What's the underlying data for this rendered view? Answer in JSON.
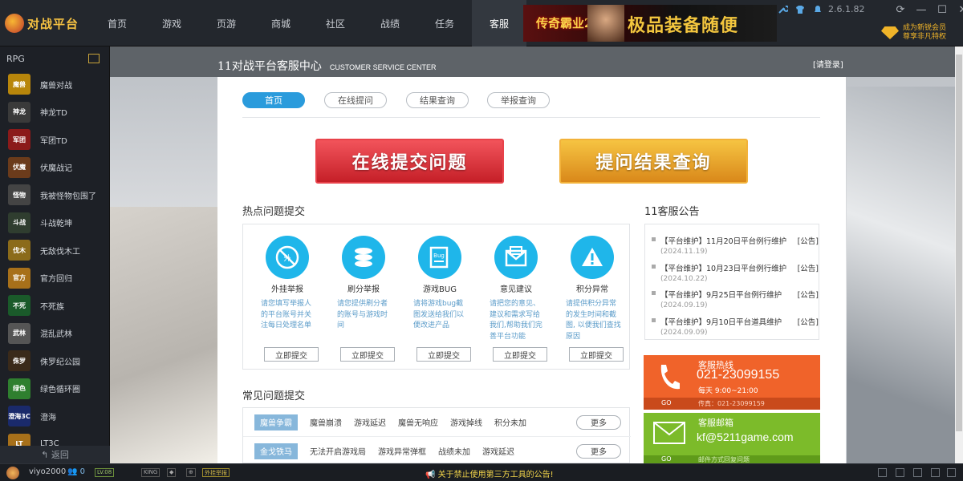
{
  "app": {
    "logo_text": "对战平台",
    "version": "2.6.1.82",
    "vip_line1": "成为新锐会员",
    "vip_line2": "尊享非凡特权"
  },
  "nav": [
    {
      "label": "首页",
      "active": false
    },
    {
      "label": "游戏",
      "active": false
    },
    {
      "label": "页游",
      "active": false
    },
    {
      "label": "商城",
      "active": false
    },
    {
      "label": "社区",
      "active": false
    },
    {
      "label": "战绩",
      "active": false
    },
    {
      "label": "任务",
      "active": false
    },
    {
      "label": "客服",
      "active": true
    }
  ],
  "banner": {
    "game_title": "传奇霸业2",
    "slogan": "极品装备随便"
  },
  "sidebar": {
    "category": "RPG",
    "back_label": "返回",
    "games": [
      {
        "name": "魔兽对战",
        "icon_text": "魔兽",
        "color": "#b8860b"
      },
      {
        "name": "神龙TD",
        "icon_text": "神龙",
        "color": "#3a3a3a"
      },
      {
        "name": "军团TD",
        "icon_text": "军团",
        "color": "#8b1a1a"
      },
      {
        "name": "伏魔战记",
        "icon_text": "伏魔",
        "color": "#6b3b1b"
      },
      {
        "name": "我被怪物包围了",
        "icon_text": "怪物",
        "color": "#444"
      },
      {
        "name": "斗战乾坤",
        "icon_text": "斗战",
        "color": "#2f3d2f"
      },
      {
        "name": "无敌伐木工",
        "icon_text": "伐木",
        "color": "#8b6b1a"
      },
      {
        "name": "官方回归",
        "icon_text": "官方",
        "color": "#a7701a"
      },
      {
        "name": "不死族",
        "icon_text": "不死",
        "color": "#1a5a2a"
      },
      {
        "name": "混乱武林",
        "icon_text": "武林",
        "color": "#555"
      },
      {
        "name": "侏罗纪公园",
        "icon_text": "侏罗",
        "color": "#3a2a1a"
      },
      {
        "name": "绿色循环圈",
        "icon_text": "绿色",
        "color": "#2f7f2f"
      },
      {
        "name": "澄海",
        "icon_text": "澄海3C",
        "color": "#1a2a6b"
      },
      {
        "name": "LT3C",
        "icon_text": "LT",
        "color": "#a7701a"
      }
    ]
  },
  "service": {
    "title": "11对战平台客服中心",
    "title_en": "CUSTOMER SERVICE CENTER",
    "login": "[请登录]",
    "tabs": [
      {
        "label": "首页",
        "active": true
      },
      {
        "label": "在线提问",
        "active": false
      },
      {
        "label": "结果查询",
        "active": false
      },
      {
        "label": "举报查询",
        "active": false
      }
    ],
    "btn_submit": "在线提交问题",
    "btn_query": "提问结果查询",
    "hot_title": "热点问题提交",
    "hot": [
      {
        "name": "外挂举报",
        "desc": "请您填写举报人的平台账号并关注每日处理名单",
        "btn": "立即提交",
        "icon": "no-cheat-icon"
      },
      {
        "name": "刷分举报",
        "desc": "请您提供刷分者的账号与游戏时间",
        "btn": "立即提交",
        "icon": "coin-stack-icon"
      },
      {
        "name": "游戏BUG",
        "desc": "请将游戏bug截图发送给我们以便改进产品",
        "btn": "立即提交",
        "icon": "bug-document-icon"
      },
      {
        "name": "意见建议",
        "desc": "请把您的意见、建议和需求写给我们,帮助我们完善平台功能",
        "btn": "立即提交",
        "icon": "mail-icon"
      },
      {
        "name": "积分异常",
        "desc": "请提供积分异常的发生时间和截图, 以便我们查找原因",
        "btn": "立即提交",
        "icon": "warning-icon"
      }
    ],
    "faq_title": "常见问题提交",
    "faq": [
      {
        "category": "魔兽争霸",
        "items": [
          "魔兽崩溃",
          "游戏延迟",
          "魔兽无响应",
          "游戏掉线",
          "积分未加"
        ],
        "more": "更多"
      },
      {
        "category": "金戈铁马",
        "items": [
          "无法开启游戏局",
          "游戏异常弹框",
          "战绩未加",
          "游戏延迟"
        ],
        "more": "更多"
      }
    ],
    "notice_title": "11客服公告",
    "notices": [
      {
        "title": "【平台维护】11月20日平台例行维护",
        "tag": "[公告]",
        "date": "(2024.11.19)"
      },
      {
        "title": "【平台维护】10月23日平台例行维护",
        "tag": "[公告]",
        "date": "(2024.10.22)"
      },
      {
        "title": "【平台维护】9月25日平台例行维护",
        "tag": "[公告]",
        "date": "(2024.09.19)"
      },
      {
        "title": "【平台维护】9月10日平台道具维护",
        "tag": "[公告]",
        "date": "(2024.09.09)"
      }
    ],
    "hotline_label": "客服热线",
    "hotline_number": "021-23099155",
    "hotline_hours": "每天 9:00~21:00",
    "fax": "传真：021-23099159",
    "go": "GO",
    "mail_label": "客服邮箱",
    "mail_address": "kf@5211game.com",
    "mail_link": "邮件方式回复问题"
  },
  "statusbar": {
    "username": "viyo2000",
    "friends": "0",
    "badge_level": "LV.08",
    "badge_plugin": "外挂举报",
    "announcement": "关于禁止使用第三方工具的公告!"
  }
}
